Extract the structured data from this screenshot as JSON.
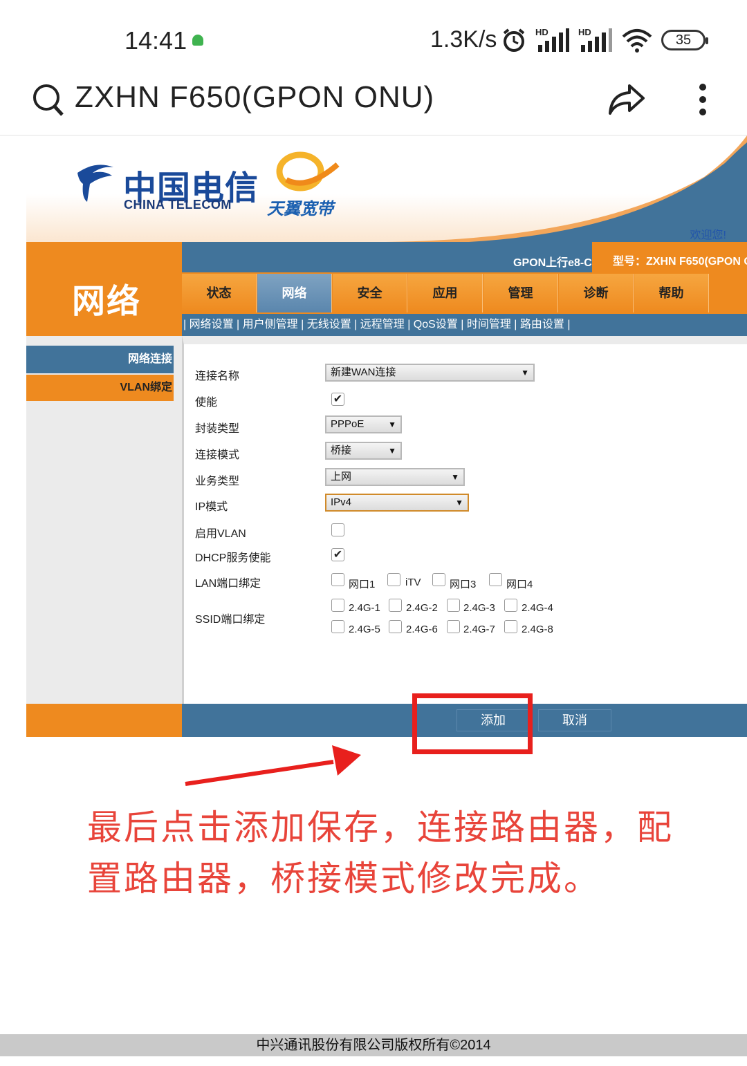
{
  "status_bar": {
    "time": "14:41",
    "net_speed": "1.3K/s",
    "battery": "35",
    "icons": [
      "android-icon",
      "alarm-icon",
      "hd-signal-icon",
      "hd-signal-icon",
      "wifi-icon",
      "battery-icon"
    ]
  },
  "browser": {
    "title": "ZXHN F650(GPON ONU)",
    "icons": [
      "search-icon",
      "share-icon",
      "more-icon"
    ]
  },
  "header": {
    "brand_cn": "中国电信",
    "brand_en": "CHINA TELECOM",
    "sub_brand": "天翼宽带",
    "welcome": "欢迎您!",
    "gpon_info": "GPON上行e8-C",
    "model": "型号：ZXHN F650(GPON O"
  },
  "section_title": "网络",
  "tabs": [
    {
      "label": "状态",
      "active": false
    },
    {
      "label": "网络",
      "active": true
    },
    {
      "label": "安全",
      "active": false
    },
    {
      "label": "应用",
      "active": false
    },
    {
      "label": "管理",
      "active": false
    },
    {
      "label": "诊断",
      "active": false
    },
    {
      "label": "帮助",
      "active": false
    }
  ],
  "sub_nav": "| 网络设置 | 用户侧管理 | 无线设置 | 远程管理 | QoS设置 | 时间管理 | 路由设置 |",
  "sidebar": {
    "items": [
      "网络连接",
      "VLAN绑定"
    ]
  },
  "form": {
    "connection_name": {
      "label": "连接名称",
      "value": "新建WAN连接"
    },
    "enable": {
      "label": "使能",
      "checked": true
    },
    "encapsulation": {
      "label": "封装类型",
      "value": "PPPoE"
    },
    "connection_mode": {
      "label": "连接模式",
      "value": "桥接"
    },
    "service_type": {
      "label": "业务类型",
      "value": "上网"
    },
    "ip_mode": {
      "label": "IP模式",
      "value": "IPv4"
    },
    "vlan": {
      "label": "启用VLAN",
      "checked": false
    },
    "dhcp": {
      "label": "DHCP服务使能",
      "checked": true
    },
    "lan_binding": {
      "label": "LAN端口绑定",
      "ports": [
        "网口1",
        "iTV",
        "网口3",
        "网口4"
      ]
    },
    "ssid_binding": {
      "label": "SSID端口绑定",
      "ports": [
        "2.4G-1",
        "2.4G-2",
        "2.4G-3",
        "2.4G-4",
        "2.4G-5",
        "2.4G-6",
        "2.4G-7",
        "2.4G-8"
      ]
    }
  },
  "buttons": {
    "add": "添加",
    "cancel": "取消"
  },
  "annotation": {
    "text": "最后点击添加保存，连接路由器，配置路由器，桥接模式修改完成。",
    "color": "#e8443a"
  },
  "footer": "中兴通讯股份有限公司版权所有©2014",
  "colors": {
    "orange": "#ee8a1f",
    "blue": "#41739a",
    "highlight_red": "#e8201d"
  }
}
